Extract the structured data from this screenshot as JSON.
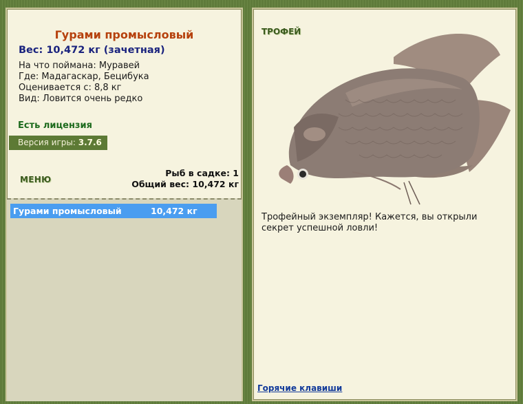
{
  "fish": {
    "title": "Гурами промысловый",
    "weight_line": "Вес: 10,472 кг (зачетная)",
    "bait": "На что поймана: Муравей",
    "place": "Где: Мадагаскар, Бецибука",
    "rating": "Оценивается с: 8,8 кг",
    "view": "Вид: Ловится очень редко"
  },
  "license": "Есть лицензия",
  "version": {
    "label": "Версия игры:",
    "value": "3.7.6"
  },
  "menu_label": "МЕНЮ",
  "keepnet": {
    "count_line": "Рыб в садке: 1",
    "total_line": "Общий вес: 10,472 кг",
    "rows": [
      {
        "name": "Гурами промысловый",
        "weight": "10,472 кг"
      }
    ]
  },
  "trophy": {
    "label": "ТРОФЕЙ",
    "image_icon": "giant-gourami-fish-picture",
    "message": "Трофейный экземпляр! Кажется, вы открыли секрет успешной ловли!"
  },
  "hotkeys_link": "Горячие клавиши",
  "colors": {
    "background": "#5e7a3a",
    "panel": "#f6f3df",
    "title": "#b6410d",
    "weight": "#1a237e",
    "license": "#1d6a1d",
    "selected_row": "#4a9df0",
    "link": "#123a9a"
  }
}
